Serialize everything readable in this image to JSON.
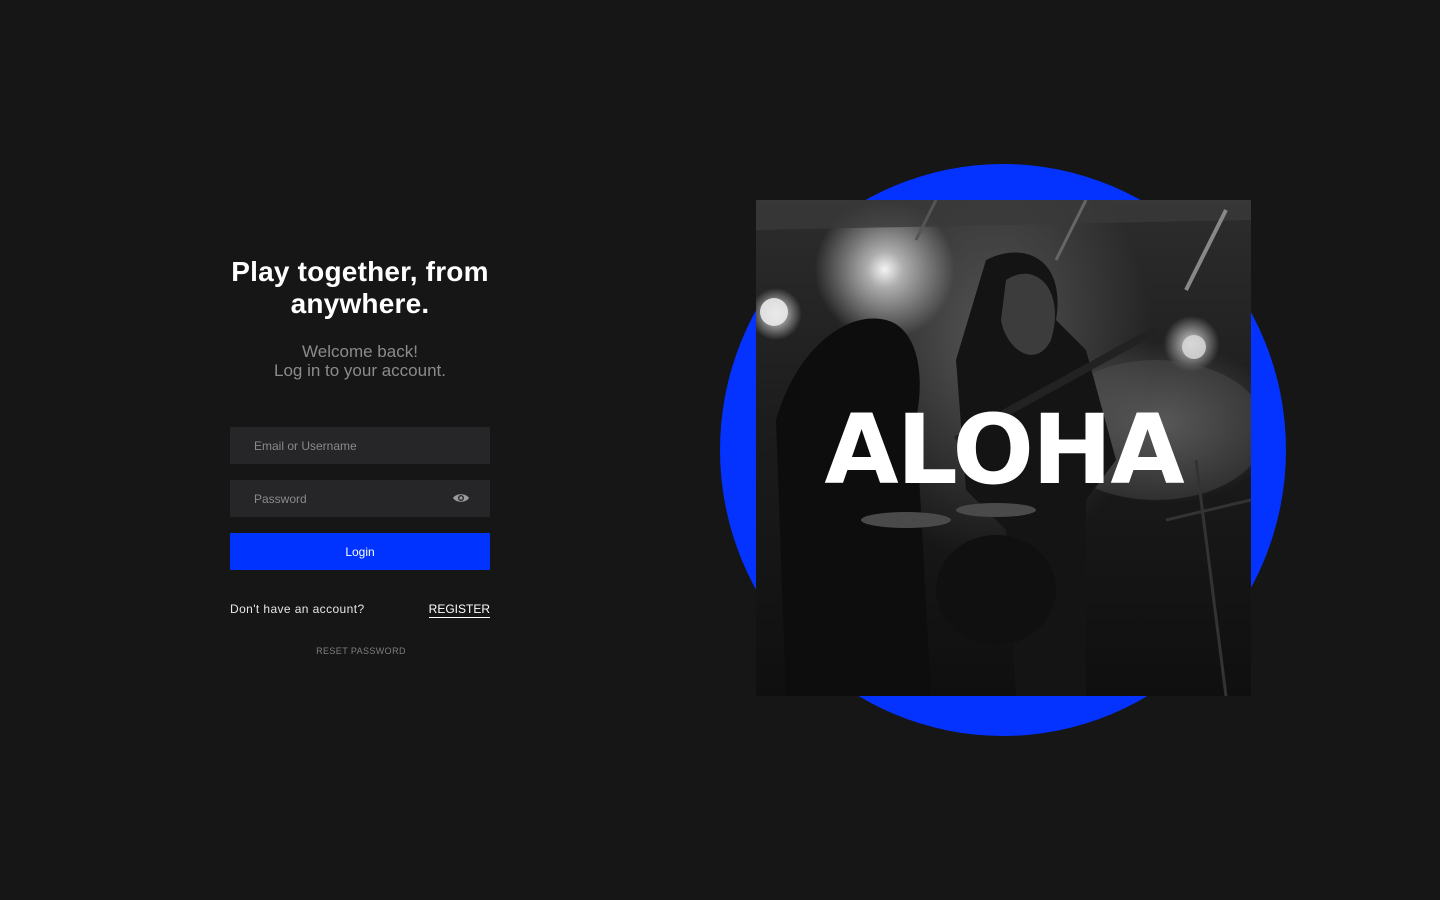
{
  "login": {
    "headline": "Play together, from anywhere.",
    "subtitle_line1": "Welcome back!",
    "subtitle_line2": "Log in to your account.",
    "email_placeholder": "Email or Username",
    "password_placeholder": "Password",
    "password_toggle_icon": "eye-icon",
    "login_label": "Login",
    "no_account_text": "Don't have an account?",
    "register_label": "REGISTER",
    "reset_label": "RESET PASSWORD"
  },
  "hero": {
    "brand_text": "ALOHA",
    "accent_color": "#0433ff"
  },
  "colors": {
    "background": "#161617",
    "field_background": "#262628",
    "button": "#0033ff"
  }
}
